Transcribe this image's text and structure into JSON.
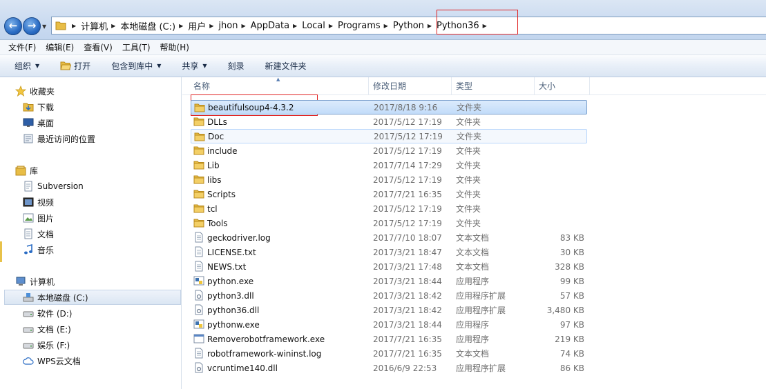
{
  "address_bar": {
    "breadcrumbs": [
      "计算机",
      "本地磁盘 (C:)",
      "用户",
      "jhon",
      "AppData",
      "Local",
      "Programs",
      "Python",
      "Python36"
    ]
  },
  "menu": [
    "文件(F)",
    "编辑(E)",
    "查看(V)",
    "工具(T)",
    "帮助(H)"
  ],
  "toolbar": {
    "organize": "组织",
    "open": "打开",
    "include_in_library": "包含到库中",
    "share": "共享",
    "burn": "刻录",
    "new_folder": "新建文件夹"
  },
  "nav": {
    "favorites": {
      "label": "收藏夹",
      "items": [
        {
          "label": "下载",
          "icon": "download-folder-icon"
        },
        {
          "label": "桌面",
          "icon": "desktop-icon"
        },
        {
          "label": "最近访问的位置",
          "icon": "recent-places-icon"
        }
      ]
    },
    "libraries": {
      "label": "库",
      "items": [
        {
          "label": "Subversion",
          "icon": "document-library-icon"
        },
        {
          "label": "视频",
          "icon": "video-icon"
        },
        {
          "label": "图片",
          "icon": "picture-icon"
        },
        {
          "label": "文档",
          "icon": "document-icon"
        },
        {
          "label": "音乐",
          "icon": "music-icon"
        }
      ]
    },
    "computer": {
      "label": "计算机",
      "items": [
        {
          "label": "本地磁盘 (C:)",
          "icon": "system-drive-icon",
          "selected": true
        },
        {
          "label": "软件 (D:)",
          "icon": "drive-icon"
        },
        {
          "label": "文档 (E:)",
          "icon": "drive-icon"
        },
        {
          "label": "娱乐 (F:)",
          "icon": "drive-icon"
        },
        {
          "label": "WPS云文档",
          "icon": "cloud-icon"
        }
      ]
    }
  },
  "columns": {
    "name": "名称",
    "date": "修改日期",
    "type": "类型",
    "size": "大小"
  },
  "files": [
    {
      "name": "beautifulsoup4-4.3.2",
      "date": "2017/8/18 9:16",
      "type": "文件夹",
      "size": "",
      "icon": "folder",
      "selected": true
    },
    {
      "name": "DLLs",
      "date": "2017/5/12 17:19",
      "type": "文件夹",
      "size": "",
      "icon": "folder"
    },
    {
      "name": "Doc",
      "date": "2017/5/12 17:19",
      "type": "文件夹",
      "size": "",
      "icon": "folder",
      "hover": true
    },
    {
      "name": "include",
      "date": "2017/5/12 17:19",
      "type": "文件夹",
      "size": "",
      "icon": "folder"
    },
    {
      "name": "Lib",
      "date": "2017/7/14 17:29",
      "type": "文件夹",
      "size": "",
      "icon": "folder"
    },
    {
      "name": "libs",
      "date": "2017/5/12 17:19",
      "type": "文件夹",
      "size": "",
      "icon": "folder"
    },
    {
      "name": "Scripts",
      "date": "2017/7/21 16:35",
      "type": "文件夹",
      "size": "",
      "icon": "folder"
    },
    {
      "name": "tcl",
      "date": "2017/5/12 17:19",
      "type": "文件夹",
      "size": "",
      "icon": "folder"
    },
    {
      "name": "Tools",
      "date": "2017/5/12 17:19",
      "type": "文件夹",
      "size": "",
      "icon": "folder"
    },
    {
      "name": "geckodriver.log",
      "date": "2017/7/10 18:07",
      "type": "文本文档",
      "size": "83 KB",
      "icon": "text"
    },
    {
      "name": "LICENSE.txt",
      "date": "2017/3/21 18:47",
      "type": "文本文档",
      "size": "30 KB",
      "icon": "text"
    },
    {
      "name": "NEWS.txt",
      "date": "2017/3/21 17:48",
      "type": "文本文档",
      "size": "328 KB",
      "icon": "text"
    },
    {
      "name": "python.exe",
      "date": "2017/3/21 18:44",
      "type": "应用程序",
      "size": "99 KB",
      "icon": "python-exe"
    },
    {
      "name": "python3.dll",
      "date": "2017/3/21 18:42",
      "type": "应用程序扩展",
      "size": "57 KB",
      "icon": "dll"
    },
    {
      "name": "python36.dll",
      "date": "2017/3/21 18:42",
      "type": "应用程序扩展",
      "size": "3,480 KB",
      "icon": "dll"
    },
    {
      "name": "pythonw.exe",
      "date": "2017/3/21 18:44",
      "type": "应用程序",
      "size": "97 KB",
      "icon": "python-exe"
    },
    {
      "name": "Removerobotframework.exe",
      "date": "2017/7/21 16:35",
      "type": "应用程序",
      "size": "219 KB",
      "icon": "exe"
    },
    {
      "name": "robotframework-wininst.log",
      "date": "2017/7/21 16:35",
      "type": "文本文档",
      "size": "74 KB",
      "icon": "text"
    },
    {
      "name": "vcruntime140.dll",
      "date": "2016/6/9 22:53",
      "type": "应用程序扩展",
      "size": "86 KB",
      "icon": "dll"
    }
  ],
  "colors": {
    "folder": "#e8bd46",
    "selection": "#c2dcf9",
    "highlight_box": "#e02020"
  }
}
